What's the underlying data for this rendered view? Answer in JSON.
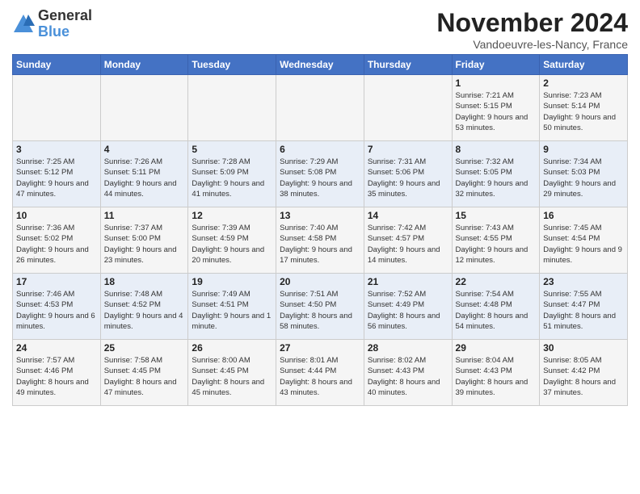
{
  "header": {
    "logo_line1": "General",
    "logo_line2": "Blue",
    "month_title": "November 2024",
    "location": "Vandoeuvre-les-Nancy, France"
  },
  "weekdays": [
    "Sunday",
    "Monday",
    "Tuesday",
    "Wednesday",
    "Thursday",
    "Friday",
    "Saturday"
  ],
  "weeks": [
    [
      {
        "day": "",
        "info": ""
      },
      {
        "day": "",
        "info": ""
      },
      {
        "day": "",
        "info": ""
      },
      {
        "day": "",
        "info": ""
      },
      {
        "day": "",
        "info": ""
      },
      {
        "day": "1",
        "info": "Sunrise: 7:21 AM\nSunset: 5:15 PM\nDaylight: 9 hours and 53 minutes."
      },
      {
        "day": "2",
        "info": "Sunrise: 7:23 AM\nSunset: 5:14 PM\nDaylight: 9 hours and 50 minutes."
      }
    ],
    [
      {
        "day": "3",
        "info": "Sunrise: 7:25 AM\nSunset: 5:12 PM\nDaylight: 9 hours and 47 minutes."
      },
      {
        "day": "4",
        "info": "Sunrise: 7:26 AM\nSunset: 5:11 PM\nDaylight: 9 hours and 44 minutes."
      },
      {
        "day": "5",
        "info": "Sunrise: 7:28 AM\nSunset: 5:09 PM\nDaylight: 9 hours and 41 minutes."
      },
      {
        "day": "6",
        "info": "Sunrise: 7:29 AM\nSunset: 5:08 PM\nDaylight: 9 hours and 38 minutes."
      },
      {
        "day": "7",
        "info": "Sunrise: 7:31 AM\nSunset: 5:06 PM\nDaylight: 9 hours and 35 minutes."
      },
      {
        "day": "8",
        "info": "Sunrise: 7:32 AM\nSunset: 5:05 PM\nDaylight: 9 hours and 32 minutes."
      },
      {
        "day": "9",
        "info": "Sunrise: 7:34 AM\nSunset: 5:03 PM\nDaylight: 9 hours and 29 minutes."
      }
    ],
    [
      {
        "day": "10",
        "info": "Sunrise: 7:36 AM\nSunset: 5:02 PM\nDaylight: 9 hours and 26 minutes."
      },
      {
        "day": "11",
        "info": "Sunrise: 7:37 AM\nSunset: 5:00 PM\nDaylight: 9 hours and 23 minutes."
      },
      {
        "day": "12",
        "info": "Sunrise: 7:39 AM\nSunset: 4:59 PM\nDaylight: 9 hours and 20 minutes."
      },
      {
        "day": "13",
        "info": "Sunrise: 7:40 AM\nSunset: 4:58 PM\nDaylight: 9 hours and 17 minutes."
      },
      {
        "day": "14",
        "info": "Sunrise: 7:42 AM\nSunset: 4:57 PM\nDaylight: 9 hours and 14 minutes."
      },
      {
        "day": "15",
        "info": "Sunrise: 7:43 AM\nSunset: 4:55 PM\nDaylight: 9 hours and 12 minutes."
      },
      {
        "day": "16",
        "info": "Sunrise: 7:45 AM\nSunset: 4:54 PM\nDaylight: 9 hours and 9 minutes."
      }
    ],
    [
      {
        "day": "17",
        "info": "Sunrise: 7:46 AM\nSunset: 4:53 PM\nDaylight: 9 hours and 6 minutes."
      },
      {
        "day": "18",
        "info": "Sunrise: 7:48 AM\nSunset: 4:52 PM\nDaylight: 9 hours and 4 minutes."
      },
      {
        "day": "19",
        "info": "Sunrise: 7:49 AM\nSunset: 4:51 PM\nDaylight: 9 hours and 1 minute."
      },
      {
        "day": "20",
        "info": "Sunrise: 7:51 AM\nSunset: 4:50 PM\nDaylight: 8 hours and 58 minutes."
      },
      {
        "day": "21",
        "info": "Sunrise: 7:52 AM\nSunset: 4:49 PM\nDaylight: 8 hours and 56 minutes."
      },
      {
        "day": "22",
        "info": "Sunrise: 7:54 AM\nSunset: 4:48 PM\nDaylight: 8 hours and 54 minutes."
      },
      {
        "day": "23",
        "info": "Sunrise: 7:55 AM\nSunset: 4:47 PM\nDaylight: 8 hours and 51 minutes."
      }
    ],
    [
      {
        "day": "24",
        "info": "Sunrise: 7:57 AM\nSunset: 4:46 PM\nDaylight: 8 hours and 49 minutes."
      },
      {
        "day": "25",
        "info": "Sunrise: 7:58 AM\nSunset: 4:45 PM\nDaylight: 8 hours and 47 minutes."
      },
      {
        "day": "26",
        "info": "Sunrise: 8:00 AM\nSunset: 4:45 PM\nDaylight: 8 hours and 45 minutes."
      },
      {
        "day": "27",
        "info": "Sunrise: 8:01 AM\nSunset: 4:44 PM\nDaylight: 8 hours and 43 minutes."
      },
      {
        "day": "28",
        "info": "Sunrise: 8:02 AM\nSunset: 4:43 PM\nDaylight: 8 hours and 40 minutes."
      },
      {
        "day": "29",
        "info": "Sunrise: 8:04 AM\nSunset: 4:43 PM\nDaylight: 8 hours and 39 minutes."
      },
      {
        "day": "30",
        "info": "Sunrise: 8:05 AM\nSunset: 4:42 PM\nDaylight: 8 hours and 37 minutes."
      }
    ]
  ]
}
